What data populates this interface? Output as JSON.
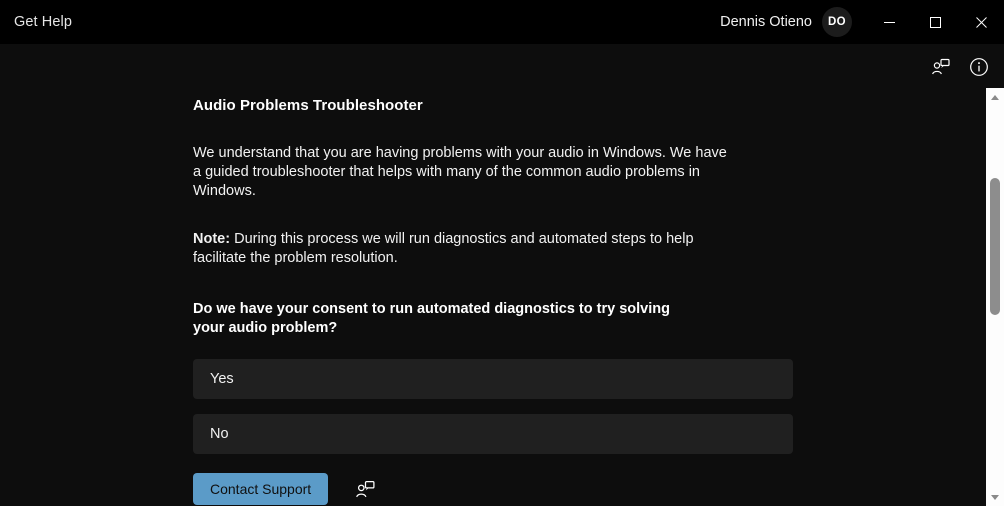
{
  "window": {
    "app_title": "Get Help",
    "account_name": "Dennis Otieno",
    "avatar_initials": "DO",
    "controls": {
      "minimize_label": "Minimize",
      "maximize_label": "Maximize",
      "close_label": "Close"
    }
  },
  "commandbar": {
    "contact_support_icon": "contact-support-icon",
    "info_icon": "info-icon"
  },
  "article": {
    "title": "Audio Problems Troubleshooter",
    "paragraph_1": "We understand that you are having problems with your audio in Windows. We have a guided troubleshooter that helps with many of the common audio problems in Windows.",
    "note_label": "Note:",
    "note_text": " During this process we will run diagnostics and automated steps to help facilitate the problem resolution.",
    "question": "Do we have your consent to run automated diagnostics to try solving your audio problem?",
    "options": [
      {
        "label": "Yes"
      },
      {
        "label": "No"
      }
    ]
  },
  "actions": {
    "contact_support_label": "Contact Support",
    "contact_support_icon": "contact-support-icon"
  },
  "scrollbar": {
    "up_arrow": "scroll-up-arrow",
    "down_arrow": "scroll-down-arrow"
  },
  "colors": {
    "titlebar_bg": "#000000",
    "page_bg": "#0d0d0d",
    "option_bg": "#202020",
    "accent_button": "#5b9bc8",
    "scrollbar_track": "#fdfdfd",
    "scrollbar_thumb": "#8d8d8d"
  }
}
